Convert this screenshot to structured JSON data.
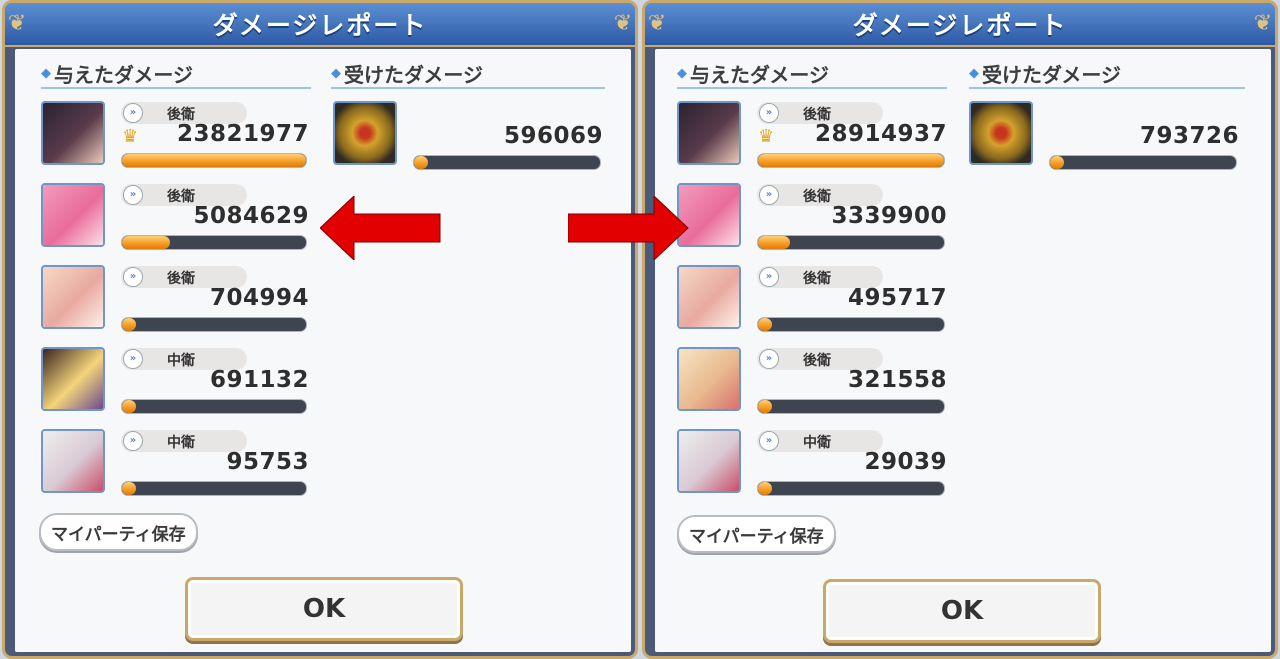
{
  "colors": {
    "accent_blue": "#3a6bbf",
    "gold_border": "#c9a86a",
    "bar_orange": "#f39a1f",
    "arrow_red": "#e20000"
  },
  "panels": [
    {
      "title": "ダメージレポート",
      "dealt_heading": "与えたダメージ",
      "taken_heading": "受けたダメージ",
      "dealt": [
        {
          "position": "後衛",
          "damage": "23821977",
          "ratio": 1.0,
          "top": true,
          "portrait": "dark-hair-girl"
        },
        {
          "position": "後衛",
          "damage": "5084629",
          "ratio": 0.26,
          "top": false,
          "portrait": "pink-hair-girl"
        },
        {
          "position": "後衛",
          "damage": "704994",
          "ratio": 0.04,
          "top": false,
          "portrait": "smiling-girl"
        },
        {
          "position": "中衛",
          "damage": "691132",
          "ratio": 0.04,
          "top": false,
          "portrait": "hat-girl"
        },
        {
          "position": "中衛",
          "damage": "95753",
          "ratio": 0.01,
          "top": false,
          "portrait": "white-hair-girl"
        }
      ],
      "taken": [
        {
          "damage": "596069",
          "ratio": 0.06,
          "portrait": "golden-boss-icon"
        }
      ],
      "save_label": "マイパーティ保存",
      "ok_label": "OK"
    },
    {
      "title": "ダメージレポート",
      "dealt_heading": "与えたダメージ",
      "taken_heading": "受けたダメージ",
      "dealt": [
        {
          "position": "後衛",
          "damage": "28914937",
          "ratio": 1.0,
          "top": true,
          "portrait": "dark-hair-girl"
        },
        {
          "position": "後衛",
          "damage": "3339900",
          "ratio": 0.17,
          "top": false,
          "portrait": "pink-hair-girl"
        },
        {
          "position": "後衛",
          "damage": "495717",
          "ratio": 0.04,
          "top": false,
          "portrait": "smiling-girl"
        },
        {
          "position": "後衛",
          "damage": "321558",
          "ratio": 0.03,
          "top": false,
          "portrait": "blonde-winking-girl"
        },
        {
          "position": "中衛",
          "damage": "29039",
          "ratio": 0.01,
          "top": false,
          "portrait": "white-hair-girl"
        }
      ],
      "taken": [
        {
          "damage": "793726",
          "ratio": 0.06,
          "portrait": "golden-boss-icon"
        }
      ],
      "save_label": "マイパーティ保存",
      "ok_label": "OK"
    }
  ]
}
